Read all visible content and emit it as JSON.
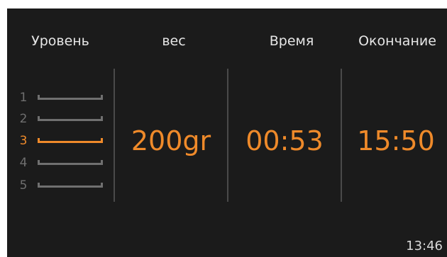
{
  "header": {
    "level": "Уровень",
    "weight": "вес",
    "time": "Время",
    "end": "Окончание"
  },
  "levels": [
    {
      "num": "1",
      "active": false
    },
    {
      "num": "2",
      "active": false
    },
    {
      "num": "3",
      "active": true
    },
    {
      "num": "4",
      "active": false
    },
    {
      "num": "5",
      "active": false
    }
  ],
  "values": {
    "weight": "200gr",
    "time": "00:53",
    "end": "15:50"
  },
  "clock": "13:46",
  "colors": {
    "background": "#1b1b1b",
    "accent": "#ef8a2a",
    "inactive": "#707070",
    "text": "#e6e6e6"
  }
}
